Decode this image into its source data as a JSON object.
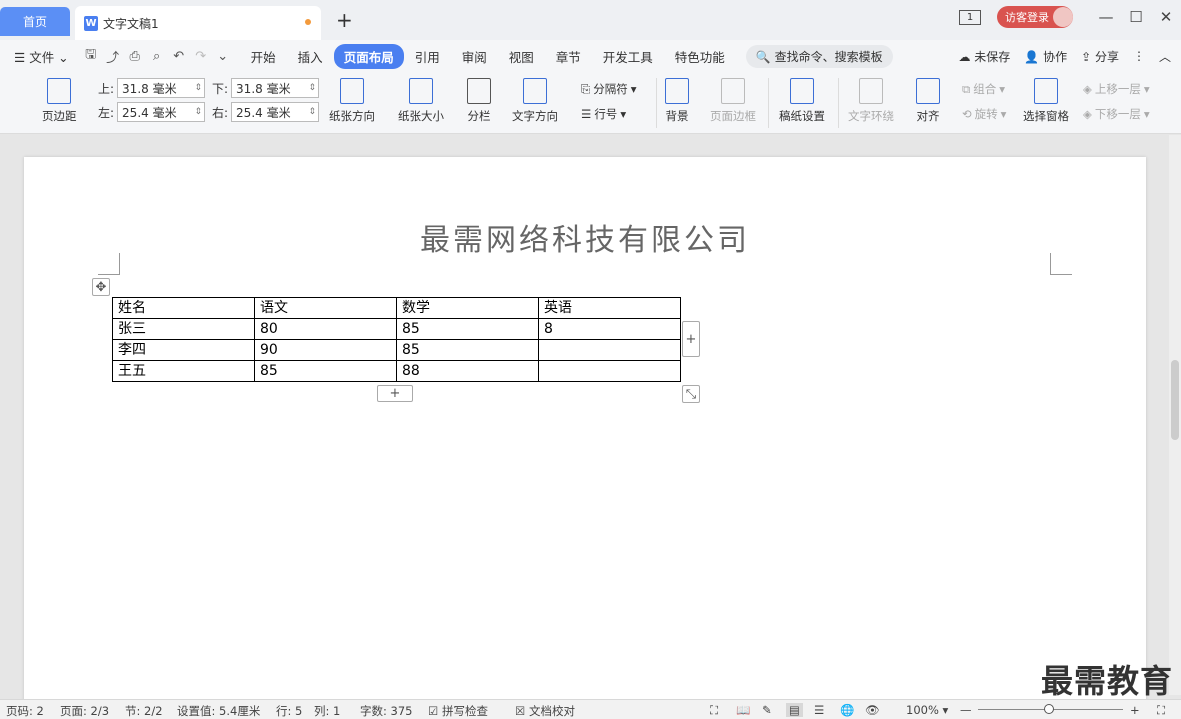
{
  "tabs": {
    "home": "首页",
    "doc": "文字文稿1",
    "doc_icon": "W"
  },
  "window": {
    "page_badge": "1",
    "login": "访客登录"
  },
  "menu": {
    "file": "文件",
    "items": [
      "开始",
      "插入",
      "页面布局",
      "引用",
      "审阅",
      "视图",
      "章节",
      "开发工具",
      "特色功能"
    ],
    "active": "页面布局",
    "search": "查找命令、搜索模板",
    "unsaved": "未保存",
    "collab": "协作",
    "share": "分享"
  },
  "ribbon": {
    "margins_btn": "页边距",
    "top_label": "上:",
    "top_val": "31.8 毫米",
    "bottom_label": "下:",
    "bottom_val": "31.8 毫米",
    "left_label": "左:",
    "left_val": "25.4 毫米",
    "right_label": "右:",
    "right_val": "25.4 毫米",
    "orientation": "纸张方向",
    "size": "纸张大小",
    "columns": "分栏",
    "text_dir": "文字方向",
    "breaks": "分隔符",
    "line_num": "行号",
    "background": "背景",
    "page_border": "页面边框",
    "manuscript": "稿纸设置",
    "wrap": "文字环绕",
    "align": "对齐",
    "group": "组合",
    "rotate": "旋转",
    "select_pane": "选择窗格",
    "bring_forward": "上移一层",
    "send_backward": "下移一层"
  },
  "document": {
    "title": "最需网络科技有限公司",
    "table": [
      [
        "姓名",
        "语文",
        "数学",
        "英语"
      ],
      [
        "张三",
        "80",
        "85",
        "8"
      ],
      [
        "李四",
        "90",
        "85",
        ""
      ],
      [
        "王五",
        "85",
        "88",
        ""
      ]
    ]
  },
  "status": {
    "page_no": "页码: 2",
    "pages": "页面: 2/3",
    "section": "节: 2/2",
    "setting": "设置值: 5.4厘米",
    "row": "行: 5",
    "col": "列: 1",
    "words": "字数: 375",
    "spell": "拼写检查",
    "proof": "文档校对",
    "zoom": "100%"
  },
  "watermark": "最需教育"
}
